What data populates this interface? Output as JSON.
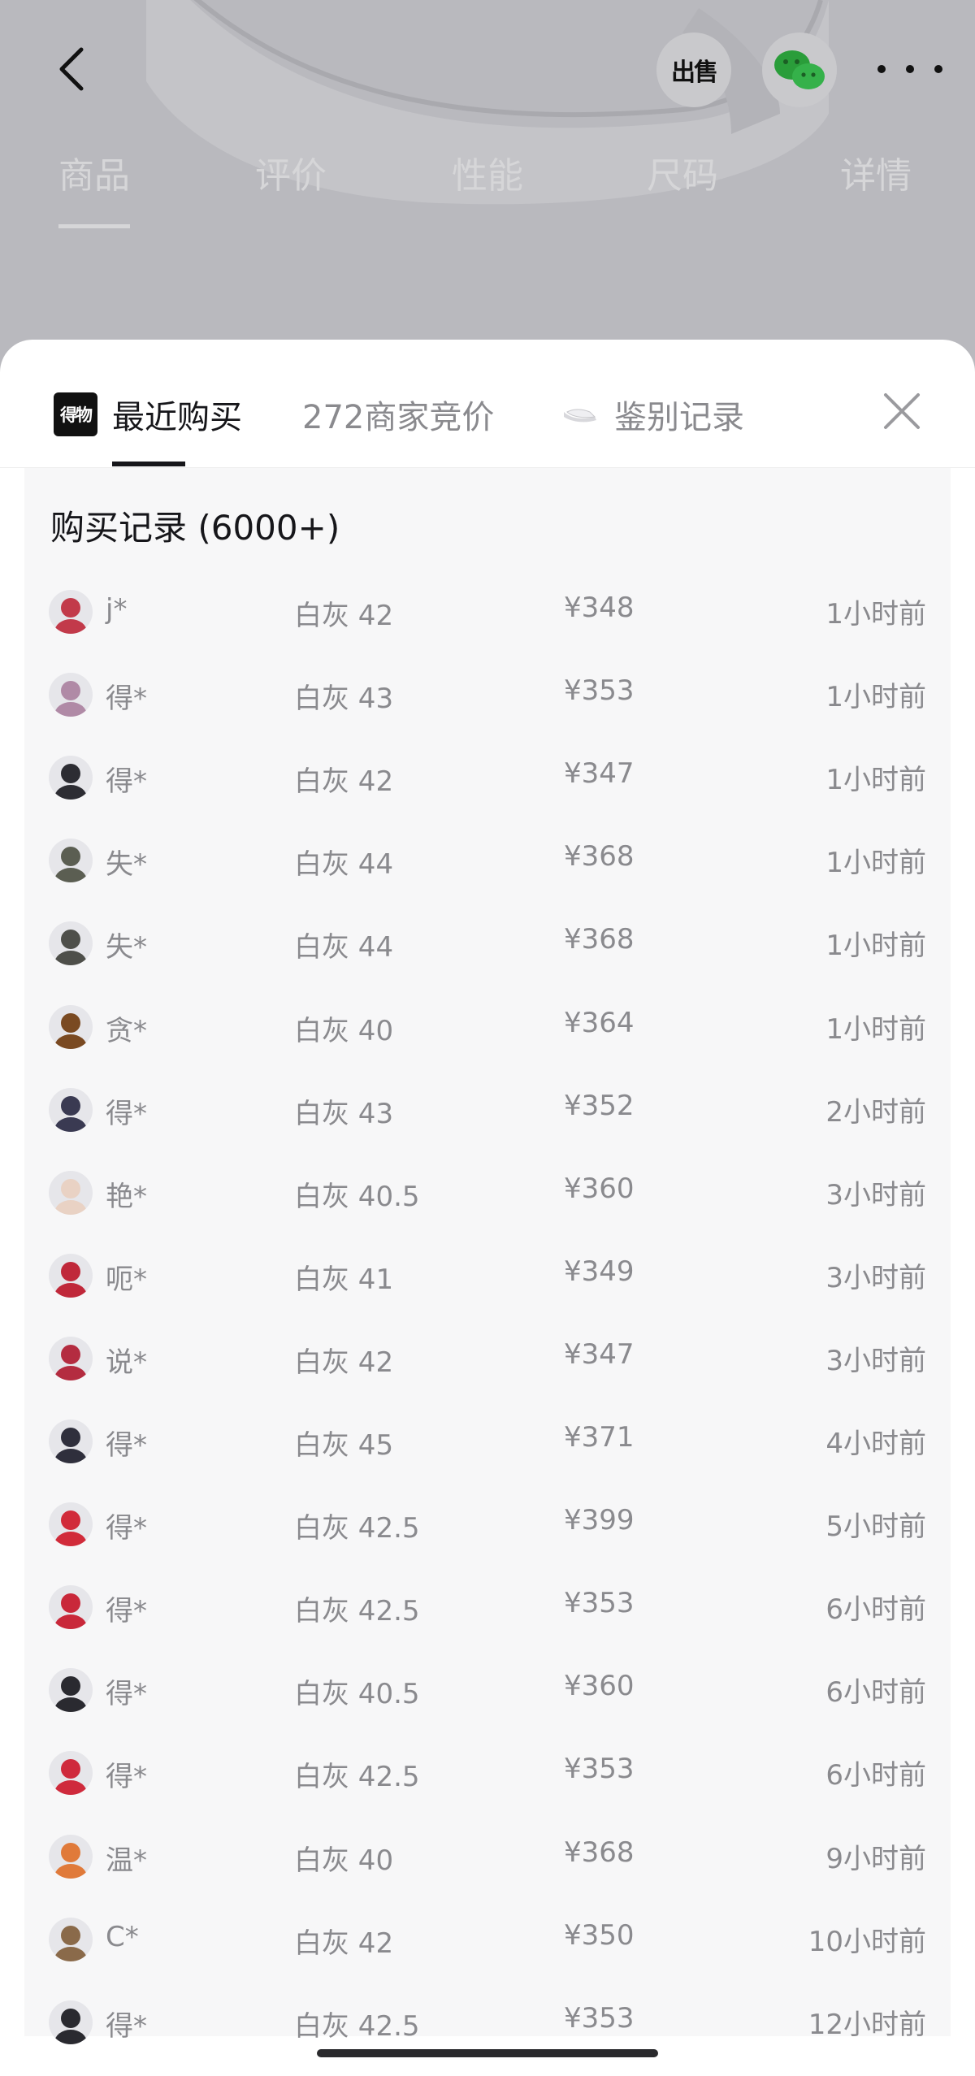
{
  "product_page": {
    "sell_label": "出售",
    "tabs": [
      {
        "label": "商品",
        "active": true
      },
      {
        "label": "评价",
        "active": false
      },
      {
        "label": "性能",
        "active": false
      },
      {
        "label": "尺码",
        "active": false
      },
      {
        "label": "详情",
        "active": false
      }
    ],
    "icons": {
      "back": "chevron-left-icon",
      "share": "wechat-icon",
      "more": "more-dots-icon"
    }
  },
  "sheet": {
    "tabs": [
      {
        "label": "最近购买",
        "icon": "dewu-logo",
        "active": true
      },
      {
        "label": "272商家竞价",
        "active": false
      },
      {
        "label": "鉴别记录",
        "icon": "shoe-thumbnail",
        "active": false
      }
    ],
    "close_icon": "close-icon",
    "records_title": "购买记录 (6000+)",
    "records": [
      {
        "user": "j*",
        "variant": "白灰 42",
        "price": "¥348",
        "time": "1小时前",
        "avatar_color": "#c23a4a"
      },
      {
        "user": "得*",
        "variant": "白灰 43",
        "price": "¥353",
        "time": "1小时前",
        "avatar_color": "#b08aa6"
      },
      {
        "user": "得*",
        "variant": "白灰 42",
        "price": "¥347",
        "time": "1小时前",
        "avatar_color": "#2d2d33"
      },
      {
        "user": "失*",
        "variant": "白灰 44",
        "price": "¥368",
        "time": "1小时前",
        "avatar_color": "#5b5e52"
      },
      {
        "user": "失*",
        "variant": "白灰 44",
        "price": "¥368",
        "time": "1小时前",
        "avatar_color": "#4e4f4a"
      },
      {
        "user": "贪*",
        "variant": "白灰 40",
        "price": "¥364",
        "time": "1小时前",
        "avatar_color": "#7a4a22"
      },
      {
        "user": "得*",
        "variant": "白灰 43",
        "price": "¥352",
        "time": "2小时前",
        "avatar_color": "#3a3a52"
      },
      {
        "user": "艳*",
        "variant": "白灰 40.5",
        "price": "¥360",
        "time": "3小时前",
        "avatar_color": "#e9d2c4"
      },
      {
        "user": "呃*",
        "variant": "白灰 41",
        "price": "¥349",
        "time": "3小时前",
        "avatar_color": "#c0283a"
      },
      {
        "user": "说*",
        "variant": "白灰 42",
        "price": "¥347",
        "time": "3小时前",
        "avatar_color": "#b42c40"
      },
      {
        "user": "得*",
        "variant": "白灰 45",
        "price": "¥371",
        "time": "4小时前",
        "avatar_color": "#2f2f3c"
      },
      {
        "user": "得*",
        "variant": "白灰 42.5",
        "price": "¥399",
        "time": "5小时前",
        "avatar_color": "#d12b3a"
      },
      {
        "user": "得*",
        "variant": "白灰 42.5",
        "price": "¥353",
        "time": "6小时前",
        "avatar_color": "#c9283a"
      },
      {
        "user": "得*",
        "variant": "白灰 40.5",
        "price": "¥360",
        "time": "6小时前",
        "avatar_color": "#2a2a30"
      },
      {
        "user": "得*",
        "variant": "白灰 42.5",
        "price": "¥353",
        "time": "6小时前",
        "avatar_color": "#cf2a3c"
      },
      {
        "user": "温*",
        "variant": "白灰 40",
        "price": "¥368",
        "time": "9小时前",
        "avatar_color": "#e07a3a"
      },
      {
        "user": "C*",
        "variant": "白灰 42",
        "price": "¥350",
        "time": "10小时前",
        "avatar_color": "#8a6a4a"
      },
      {
        "user": "得*",
        "variant": "白灰 42.5",
        "price": "¥353",
        "time": "12小时前",
        "avatar_color": "#2a2a30"
      }
    ]
  },
  "theme": {
    "text_primary": "#16161a",
    "text_secondary": "#8a8a8e",
    "panel_bg": "#f7f7f8"
  }
}
